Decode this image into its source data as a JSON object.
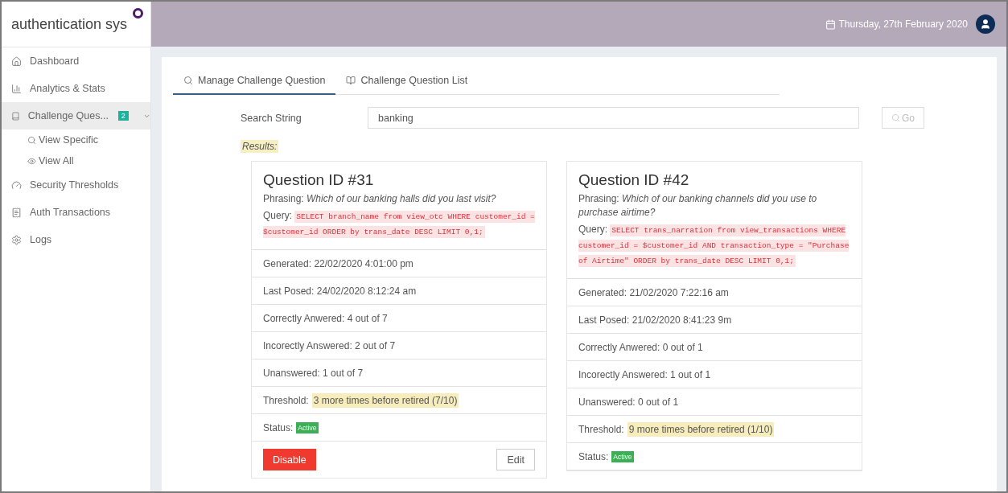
{
  "app": {
    "title": "authentication sys"
  },
  "header": {
    "date": "Thursday, 27th February 2020"
  },
  "sidebar": {
    "items": [
      {
        "kind": "home",
        "label": "Dashboard",
        "selected": false
      },
      {
        "kind": "chart",
        "label": "Analytics & Stats",
        "selected": false
      },
      {
        "kind": "book",
        "label": "Challenge Ques...",
        "selected": true,
        "badge": "2",
        "expanded": true,
        "children": [
          {
            "kind": "search",
            "label": "View Specific"
          },
          {
            "kind": "eye",
            "label": "View All"
          }
        ]
      },
      {
        "kind": "gauge",
        "label": "Security Thresholds",
        "selected": false
      },
      {
        "kind": "receipt",
        "label": "Auth Transactions",
        "selected": false
      },
      {
        "kind": "gear",
        "label": "Logs",
        "selected": false
      }
    ]
  },
  "tabs": [
    {
      "kind": "search",
      "label": "Manage Challenge Question",
      "selected": true
    },
    {
      "kind": "book",
      "label": "Challenge Question List",
      "selected": false
    }
  ],
  "search": {
    "label": "Search String",
    "value": "banking",
    "button": "Go"
  },
  "results_label": "Results:",
  "cards": [
    {
      "title": "Question ID #31",
      "phrasing_label": "Phrasing:",
      "phrasing": "Which of our banking halls did you last visit?",
      "query_label": "Query:",
      "query": "SELECT branch_name from view_otc WHERE customer_id = $customer_id ORDER by trans_date DESC LIMIT 0,1;",
      "rows": [
        {
          "kind": "text",
          "text": "Generated: 22/02/2020 4:01:00 pm"
        },
        {
          "kind": "text",
          "text": "Last Posed: 24/02/2020 8:12:24 am"
        },
        {
          "kind": "text",
          "text": "Correctly Anwered: 4 out of 7"
        },
        {
          "kind": "text",
          "text": "Incorectly Answered: 2 out of 7"
        },
        {
          "kind": "text",
          "text": "Unanswered: 1 out of 7"
        },
        {
          "kind": "highlight",
          "label": "Threshold:",
          "value": "3 more times before retired (7/10)"
        },
        {
          "kind": "badge",
          "label": "Status:",
          "value": "Active"
        }
      ],
      "actions": [
        {
          "kind": "danger",
          "label": "Disable"
        },
        {
          "kind": "plain",
          "label": "Edit"
        }
      ]
    },
    {
      "title": "Question ID #42",
      "phrasing_label": "Phrasing:",
      "phrasing": "Which of our banking channels did you use to purchase airtime?",
      "query_label": "Query:",
      "query": "SELECT trans_narration from view_transactions WHERE customer_id = $customer_id AND transaction_type = \"Purchase of Airtime\" ORDER by trans_date DESC LIMIT 0,1;",
      "rows": [
        {
          "kind": "text",
          "text": "Generated: 21/02/2020 7:22:16 am"
        },
        {
          "kind": "text",
          "text": "Last Posed: 21/02/2020 8:41:23 9m"
        },
        {
          "kind": "text",
          "text": "Correctly Anwered: 0 out of 1"
        },
        {
          "kind": "text",
          "text": "Incorectly Answered: 1 out of 1"
        },
        {
          "kind": "text",
          "text": "Unanswered: 0 out of 1"
        },
        {
          "kind": "highlight",
          "label": "Threshold:",
          "value": "9 more times before retired (1/10)"
        },
        {
          "kind": "badge",
          "label": "Status:",
          "value": "Active"
        }
      ]
    }
  ]
}
